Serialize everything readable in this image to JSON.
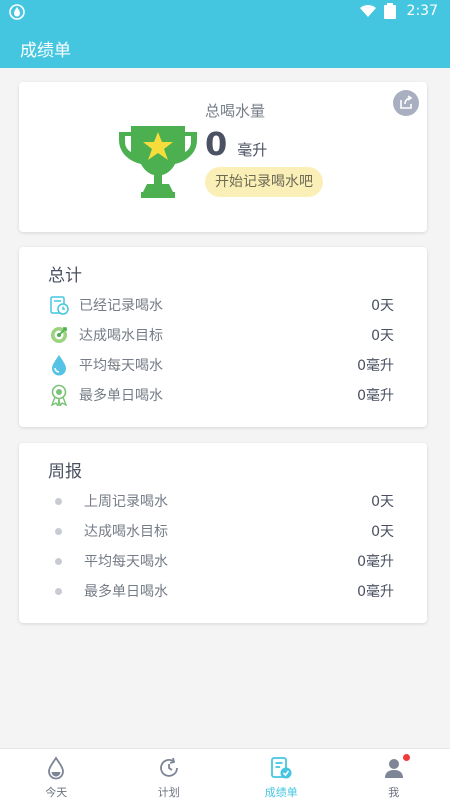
{
  "status_bar": {
    "time": "2:37",
    "colors": {
      "bg": "#45c6e0"
    }
  },
  "app_bar": {
    "title": "成绩单"
  },
  "summary": {
    "label": "总喝水量",
    "value": "0",
    "unit": "毫升",
    "start_button": "开始记录喝水吧",
    "icons": {
      "trophy": "trophy-icon",
      "share": "share-icon"
    }
  },
  "totals": {
    "title": "总计",
    "rows": [
      {
        "label": "已经记录喝水",
        "value": "0天",
        "icon": "calendar-clock-icon"
      },
      {
        "label": "达成喝水目标",
        "value": "0天",
        "icon": "target-icon"
      },
      {
        "label": "平均每天喝水",
        "value": "0毫升",
        "icon": "water-drop-icon"
      },
      {
        "label": "最多单日喝水",
        "value": "0毫升",
        "icon": "medal-icon"
      }
    ]
  },
  "weekly": {
    "title": "周报",
    "rows": [
      {
        "label": "上周记录喝水",
        "value": "0天"
      },
      {
        "label": "达成喝水目标",
        "value": "0天"
      },
      {
        "label": "平均每天喝水",
        "value": "0毫升"
      },
      {
        "label": "最多单日喝水",
        "value": "0毫升"
      }
    ]
  },
  "bottom_nav": {
    "items": [
      {
        "label": "今天",
        "icon": "water-drop-icon"
      },
      {
        "label": "计划",
        "icon": "clock-icon"
      },
      {
        "label": "成绩单",
        "icon": "report-icon",
        "active": true
      },
      {
        "label": "我",
        "icon": "user-icon",
        "badge": true
      }
    ]
  },
  "colors": {
    "accent": "#45c6e0",
    "trophy": "#4caf50",
    "star": "#f6dd3b",
    "pill": "#fbefb8",
    "badge": "#ef3b3b"
  }
}
